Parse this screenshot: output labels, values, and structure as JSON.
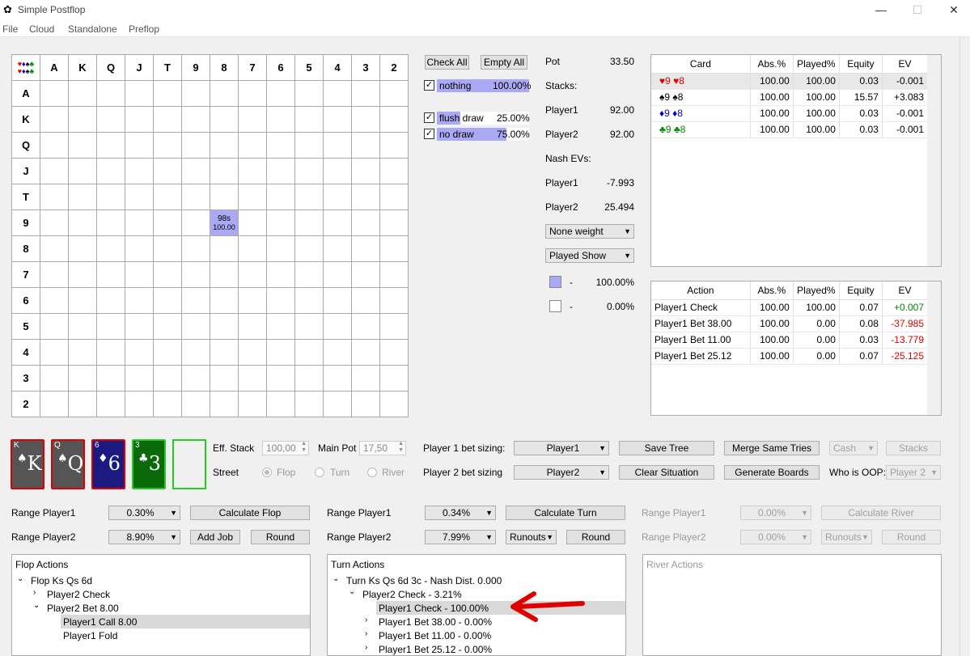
{
  "window": {
    "title": "Simple Postflop",
    "minimize": "—",
    "maximize": "☐",
    "close": "✕"
  },
  "menu": [
    "File",
    "Cloud",
    "Standalone",
    "Preflop"
  ],
  "grid": {
    "corner_suits": "♥♦♠♣",
    "cols": [
      "A",
      "K",
      "Q",
      "J",
      "T",
      "9",
      "8",
      "7",
      "6",
      "5",
      "4",
      "3",
      "2"
    ],
    "rows": [
      "A",
      "K",
      "Q",
      "J",
      "T",
      "9",
      "8",
      "7",
      "6",
      "5",
      "4",
      "3",
      "2"
    ],
    "hand": {
      "label": "98s",
      "weight": "100.00"
    }
  },
  "filters": {
    "check_all": "Check All",
    "empty_all": "Empty All",
    "items": [
      {
        "label": "nothing",
        "pct": "100.00%",
        "fill": 1.0,
        "checked": true
      },
      {
        "label": "flush draw",
        "pct": "25.00%",
        "fill": 0.25,
        "checked": true
      },
      {
        "label": "no draw",
        "pct": "75.00%",
        "fill": 0.75,
        "checked": true
      }
    ]
  },
  "info": {
    "pot_label": "Pot",
    "pot": "33.50",
    "stacks_label": "Stacks:",
    "p1_label": "Player1",
    "p1_stack": "92.00",
    "p2_label": "Player2",
    "p2_stack": "92.00",
    "nash_label": "Nash EVs:",
    "p1_nash_label": "Player1",
    "p1_nash": "-7.993",
    "p2_nash_label": "Player2",
    "p2_nash": "25.494",
    "weight_combo": "None weight",
    "show_combo": "Played Show",
    "legend1_dash": "-",
    "legend1_pct": "100.00%",
    "legend2_dash": "-",
    "legend2_pct": "0.00%"
  },
  "card_table": {
    "headers": [
      "Card",
      "Abs.%",
      "Played%",
      "Equity",
      "EV"
    ],
    "rows": [
      {
        "s1": "♥",
        "r1": "9",
        "s2": "♥",
        "r2": "8",
        "c1": "#d00",
        "c2": "#d00",
        "abs": "100.00",
        "played": "100.00",
        "eq": "0.03",
        "ev": "-0.001"
      },
      {
        "s1": "♠",
        "r1": "9",
        "s2": "♠",
        "r2": "8",
        "c1": "#000",
        "c2": "#000",
        "abs": "100.00",
        "played": "100.00",
        "eq": "15.57",
        "ev": "+3.083"
      },
      {
        "s1": "♦",
        "r1": "9",
        "s2": "♦",
        "r2": "8",
        "c1": "#0000d0",
        "c2": "#0000d0",
        "abs": "100.00",
        "played": "100.00",
        "eq": "0.03",
        "ev": "-0.001"
      },
      {
        "s1": "♣",
        "r1": "9",
        "s2": "♣",
        "r2": "8",
        "c1": "#080",
        "c2": "#080",
        "abs": "100.00",
        "played": "100.00",
        "eq": "0.03",
        "ev": "-0.001"
      }
    ]
  },
  "action_table": {
    "headers": [
      "Action",
      "Abs.%",
      "Played%",
      "Equity",
      "EV"
    ],
    "rows": [
      {
        "action": "Player1 Check",
        "abs": "100.00",
        "played": "100.00",
        "eq": "0.07",
        "ev": "+0.007",
        "color": "#080"
      },
      {
        "action": "Player1 Bet 38.00",
        "abs": "100.00",
        "played": "0.00",
        "eq": "0.08",
        "ev": "-37.985",
        "color": "#d00"
      },
      {
        "action": "Player1 Bet 11.00",
        "abs": "100.00",
        "played": "0.00",
        "eq": "0.03",
        "ev": "-13.779",
        "color": "#d00"
      },
      {
        "action": "Player1 Bet 25.12",
        "abs": "100.00",
        "played": "0.00",
        "eq": "0.07",
        "ev": "-25.125",
        "color": "#d00"
      }
    ]
  },
  "board": [
    {
      "rank": "K",
      "suit": "♠",
      "bg": "#555"
    },
    {
      "rank": "Q",
      "suit": "♠",
      "bg": "#555"
    },
    {
      "rank": "6",
      "suit": "♦",
      "bg": "#1a1a80"
    },
    {
      "rank": "3",
      "suit": "♣",
      "bg": "#0a6a0a"
    }
  ],
  "settings": {
    "eff_stack_label": "Eff. Stack",
    "eff_stack": "100,00",
    "main_pot_label": "Main Pot",
    "main_pot": "17,50",
    "street_label": "Street",
    "flop": "Flop",
    "turn": "Turn",
    "river": "River",
    "p1_sizing_label": "Player 1 bet sizing:",
    "p1_sizing": "Player1",
    "p2_sizing_label": "Player 2 bet sizing",
    "p2_sizing": "Player2",
    "save_tree": "Save Tree",
    "clear_situation": "Clear Situation",
    "merge": "Merge Same Tries",
    "generate": "Generate Boards",
    "cash": "Cash",
    "stacks": "Stacks",
    "who_oop_label": "Who is OOP:",
    "who_oop": "Player 2"
  },
  "flop": {
    "range1_label": "Range Player1",
    "range1": "0.30%",
    "range2_label": "Range Player2",
    "range2": "8.90%",
    "calc": "Calculate Flop",
    "add_job": "Add Job",
    "round": "Round"
  },
  "turn": {
    "range1_label": "Range Player1",
    "range1": "0.34%",
    "range2_label": "Range Player2",
    "range2": "7.99%",
    "calc": "Calculate Turn",
    "runouts": "Runouts",
    "round": "Round"
  },
  "river": {
    "range1_label": "Range Player1",
    "range1": "0.00%",
    "range2_label": "Range Player2",
    "range2": "0.00%",
    "calc": "Calculate River",
    "runouts": "Runouts",
    "round": "Round"
  },
  "flop_actions": {
    "title": "Flop Actions",
    "items": [
      "Flop Ks Qs 6d",
      "Player2 Check",
      "Player2 Bet 8.00",
      "Player1 Call 8.00",
      "Player1 Fold"
    ]
  },
  "turn_actions": {
    "title": "Turn Actions",
    "items": [
      "Turn Ks Qs 6d 3c - Nash Dist. 0.000",
      "Player2 Check - 3.21%",
      "Player1 Check - 100.00%",
      "Player1 Bet 38.00 - 0.00%",
      "Player1 Bet 11.00 - 0.00%",
      "Player1 Bet 25.12 - 0.00%"
    ]
  },
  "river_actions": {
    "title": "River Actions"
  },
  "colors": {
    "accent": "#a9a9f5",
    "arrow": "#e00000"
  }
}
